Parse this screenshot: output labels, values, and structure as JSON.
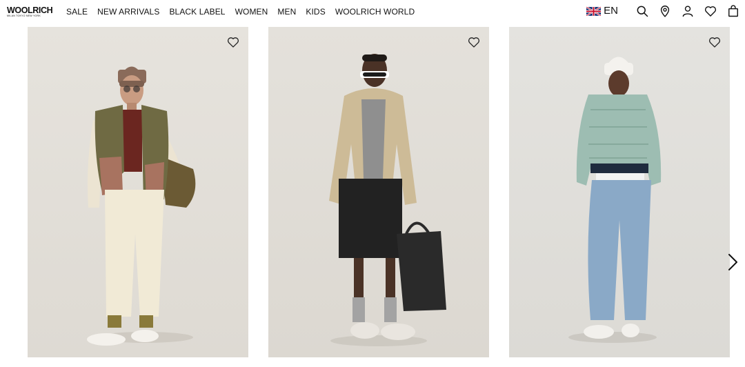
{
  "brand": {
    "name": "WOOLRICH",
    "tagline": "MILAN TOKYO NEW YORK"
  },
  "nav": [
    {
      "label": "SALE"
    },
    {
      "label": "NEW ARRIVALS"
    },
    {
      "label": "BLACK LABEL"
    },
    {
      "label": "WOMEN"
    },
    {
      "label": "MEN"
    },
    {
      "label": "KIDS"
    },
    {
      "label": "WOOLRICH WORLD"
    }
  ],
  "tools": {
    "language": "EN",
    "flag_icon": "uk-flag-icon",
    "icons": [
      "search-icon",
      "store-locator-icon",
      "account-icon",
      "wishlist-icon",
      "cart-icon"
    ]
  },
  "products": [
    {
      "image": "woman-quilted-vest-beanie",
      "wishlist_icon": "heart-icon"
    },
    {
      "image": "man-hooded-jacket-shorts-tote",
      "wishlist_icon": "heart-icon"
    },
    {
      "image": "woman-puffer-jacket-jeans",
      "wishlist_icon": "heart-icon"
    }
  ],
  "carousel": {
    "next_icon": "chevron-right-icon"
  },
  "colors": {
    "text": "#111111",
    "background": "#ffffff",
    "card_bg": "#e2dfd9"
  }
}
